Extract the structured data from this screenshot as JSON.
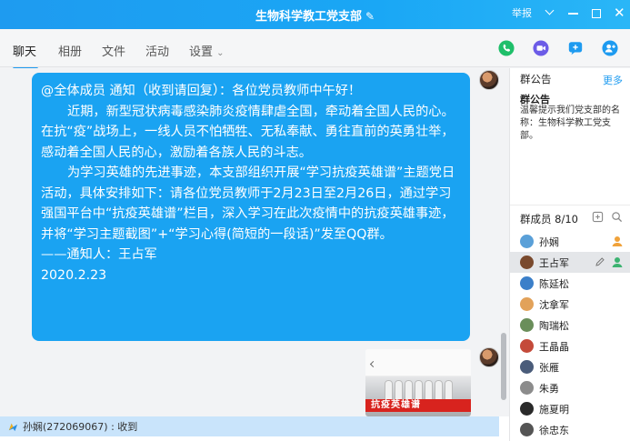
{
  "window": {
    "title": "生物科学教工党支部",
    "report_label": "举报"
  },
  "tabs": [
    {
      "label": "聊天"
    },
    {
      "label": "相册"
    },
    {
      "label": "文件"
    },
    {
      "label": "活动"
    },
    {
      "label": "设置"
    }
  ],
  "message": {
    "header": "@全体成员 通知（收到请回复）：各位党员教师中午好！",
    "para1": "近期，新型冠状病毒感染肺炎疫情肆虐全国，牵动着全国人民的心。在抗“疫”战场上，一线人员不怕牺牲、无私奉献、勇往直前的英勇壮举，感动着全国人民的心，激励着各族人民的斗志。",
    "para2": "为学习英雄的先进事迹，本支部组织开展“学习抗疫英雄谱”主题党日活动，具体安排如下：请各位党员教师于2月23日至2月26日，通过学习强国平台中“抗疫英雄谱”栏目，深入学习在此次疫情中的抗疫英雄事迹，并将“学习主题截图”+“学习心得(简短的一段话)”发至QQ群。",
    "signature": "——通知人：王占军",
    "date": "2020.2.23"
  },
  "image_card": {
    "banner_text": "抗疫英雄谱"
  },
  "statusbar": {
    "text": "孙娴(272069067) : 收到"
  },
  "sidebar": {
    "announcement_header": "群公告",
    "more_label": "更多",
    "notice_title": "群公告",
    "notice_body": "温馨提示我们党支部的名称：生物科学教工党支部。",
    "members_header": "群成员 8/10",
    "members": [
      {
        "name": "孙娴",
        "avatar_color": "#5aa0d8",
        "role": "owner"
      },
      {
        "name": "王占军",
        "avatar_color": "#7a4a2e",
        "role": "admin",
        "selected": true
      },
      {
        "name": "陈延松",
        "avatar_color": "#3b7fc9"
      },
      {
        "name": "沈拿军",
        "avatar_color": "#e2a25a"
      },
      {
        "name": "陶瑞松",
        "avatar_color": "#6a8e5a"
      },
      {
        "name": "王晶晶",
        "avatar_color": "#c44a3a"
      },
      {
        "name": "张雁",
        "avatar_color": "#4a5c7a"
      },
      {
        "name": "朱勇",
        "avatar_color": "#8c8c8c"
      },
      {
        "name": "施夏明",
        "avatar_color": "#2a2a2a"
      },
      {
        "name": "徐忠东",
        "avatar_color": "#555555"
      }
    ]
  },
  "colors": {
    "accent": "#1e9bf0",
    "bubble": "#1aa3f2",
    "statusbar": "#c9e4fb"
  }
}
